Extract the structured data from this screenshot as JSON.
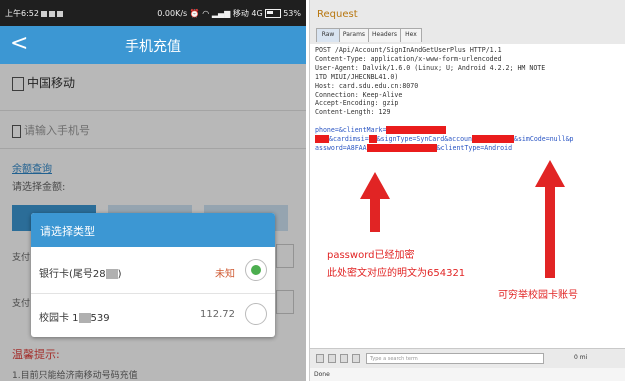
{
  "phone": {
    "status": {
      "time": "上午6:52",
      "speed": "0.00K/s",
      "carrier": "移动 4G",
      "battery": "53%"
    },
    "title": "手机充值",
    "carrier_name": "中国移动",
    "phone_placeholder": "请输入手机号",
    "balance_link": "余额查询",
    "select_amount_label": "请选择金额:",
    "pay_labels": [
      "支付",
      "支付"
    ],
    "tips_title": "温馨提示:",
    "tips_text": "1.目前只能给济南移动号码充值",
    "dialog": {
      "title": "请选择类型",
      "options": [
        {
          "prefix": "银行卡(尾号28",
          "suffix": ")",
          "value": "未知",
          "selected": true
        },
        {
          "prefix": "校园卡 1",
          "suffix": "539",
          "value": "112.72",
          "selected": false
        }
      ]
    }
  },
  "request": {
    "title": "Request",
    "tabs": [
      "Raw",
      "Params",
      "Headers",
      "Hex"
    ],
    "active_tab": "Raw",
    "lines": [
      "POST /Api/Account/SignInAndGetUserPlus HTTP/1.1",
      "Content-Type: application/x-www-form-urlencoded",
      "User-Agent: Dalvik/1.6.0 (Linux; U; Android 4.2.2; HM NOTE",
      "1TD MIUI/JHECNBL41.0)",
      "Host: card.sdu.edu.cn:8070",
      "Connection: Keep-Alive",
      "Accept-Encoding: gzip",
      "Content-Length: 129"
    ],
    "body_line1": "phone=&clientMark=",
    "body_line2_a": "&cardimsi=",
    "body_line2_b": "&signType=SynCard&accoun",
    "body_line2_c": "&simCode=null&p",
    "body_line3_a": "assword=A8FAA",
    "body_line3_b": "&clientType=Android",
    "annotation_password_1": "password已经加密",
    "annotation_password_2": "此处密文对应的明文为654321",
    "annotation_account": "可穷举校园卡账号",
    "search_placeholder": "Type a search term",
    "matches": "0 mi",
    "status": "Done",
    "buttons": [
      "?",
      "<",
      "+",
      ">"
    ]
  },
  "colors": {
    "accent": "#3c97d3",
    "annotation": "#e12424",
    "param": "#2b56c4"
  }
}
